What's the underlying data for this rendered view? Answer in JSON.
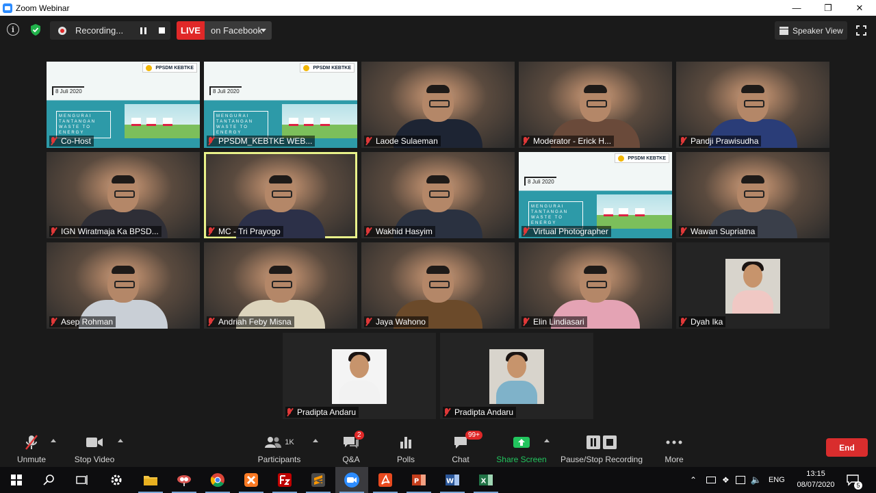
{
  "window": {
    "title": "Zoom Webinar"
  },
  "topbar": {
    "recording_label": "Recording...",
    "live_label": "LIVE",
    "live_destination": "on Facebook",
    "speaker_view_label": "Speaker View"
  },
  "banner": {
    "date": "8 Juli 2020",
    "logo": "PPSDM KEBTKE",
    "headline": "MENGURAI TANTANGAN WASTE TO ENERGY"
  },
  "participants": [
    {
      "name": "Co-Host",
      "kind": "banner"
    },
    {
      "name": "PPSDM_KEBTKE WEB...",
      "kind": "banner"
    },
    {
      "name": "Laode Sulaeman",
      "kind": "person",
      "shirt": "#1d2433"
    },
    {
      "name": "Moderator - Erick H...",
      "kind": "person",
      "shirt": "#6a4a3a"
    },
    {
      "name": "Pandji Prawisudha",
      "kind": "person",
      "shirt": "#2a3d78"
    },
    {
      "name": "IGN Wiratmaja Ka BPSD...",
      "kind": "person",
      "shirt": "#2e2e36"
    },
    {
      "name": "MC - Tri Prayogo",
      "kind": "person",
      "shirt": "#2c3048",
      "active": true
    },
    {
      "name": "Wakhid Hasyim",
      "kind": "person",
      "shirt": "#2a3140"
    },
    {
      "name": "Virtual Photographer",
      "kind": "banner"
    },
    {
      "name": "Wawan Supriatna",
      "kind": "person",
      "shirt": "#3a3f4a"
    },
    {
      "name": "Asep Rohman",
      "kind": "person",
      "shirt": "#c9cfd6"
    },
    {
      "name": "Andriah Feby Misna",
      "kind": "person",
      "shirt": "#dcd4bc"
    },
    {
      "name": "Jaya Wahono",
      "kind": "person",
      "shirt": "#6b4a2a"
    },
    {
      "name": "Elin Lindiasari",
      "kind": "person",
      "shirt": "#e4a3b4"
    },
    {
      "name": "Dyah Ika",
      "kind": "photo",
      "shirt": "#f0c8c4"
    },
    {
      "name": "Pradipta Andaru",
      "kind": "photo",
      "shirt": "#f2f2f2"
    },
    {
      "name": "Pradipta Andaru",
      "kind": "photo",
      "shirt": "#7fb2c9"
    }
  ],
  "controls": {
    "unmute": "Unmute",
    "stop_video": "Stop Video",
    "participants": "Participants",
    "participants_count": "1K",
    "qa": "Q&A",
    "qa_badge": "2",
    "polls": "Polls",
    "chat": "Chat",
    "chat_badge": "99+",
    "share_screen": "Share Screen",
    "pause_stop_recording": "Pause/Stop Recording",
    "more": "More",
    "end": "End"
  },
  "taskbar": {
    "lang": "ENG",
    "time": "13:15",
    "date": "08/07/2020",
    "notifications": "5"
  },
  "colors": {
    "accent_green": "#22c55e",
    "live_red": "#e02828",
    "active_outline": "#e9f28a"
  }
}
